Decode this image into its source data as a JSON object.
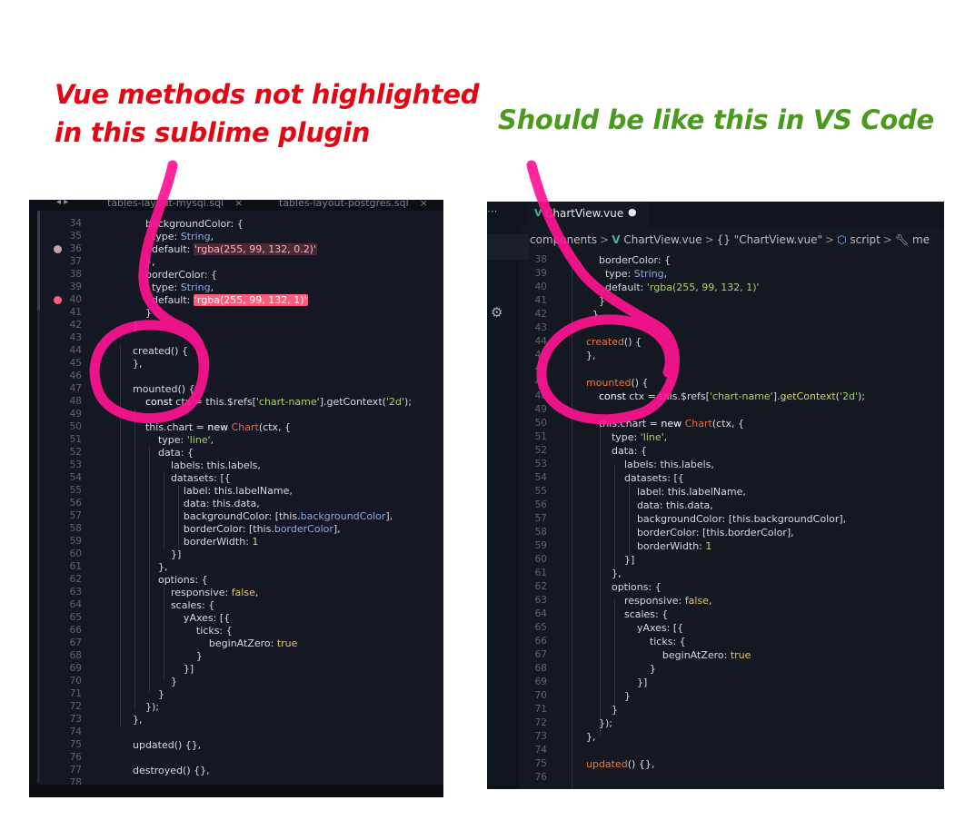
{
  "captions": {
    "left": [
      "Vue methods not highlighted",
      "in this sublime plugin"
    ],
    "right": "Should be like this in VS Code"
  },
  "sublime": {
    "tabs": [
      {
        "label": "tables-layout-mysql.sql",
        "close": "×"
      },
      {
        "label": "tables-layout-postgres.sql",
        "close": "×"
      }
    ],
    "nav_arrows": "◂ ▸",
    "line_numbers": [
      "34",
      "35",
      "36",
      "37",
      "38",
      "39",
      "40",
      "41",
      "42",
      "43",
      "44",
      "45",
      "46",
      "47",
      "48",
      "49",
      "50",
      "51",
      "52",
      "53",
      "54",
      "55",
      "56",
      "57",
      "58",
      "59",
      "60",
      "61",
      "62",
      "63",
      "64",
      "65",
      "66",
      "67",
      "68",
      "69",
      "70",
      "71",
      "72",
      "73",
      "74",
      "75",
      "76",
      "77",
      "78"
    ],
    "dots": {
      "line36": "#c8a0a8",
      "line40": "#ff5c7a"
    }
  },
  "vscode": {
    "more_icon": "···",
    "tab": {
      "label": "ChartView.vue",
      "modified_dot": "●"
    },
    "breadcrumb": [
      "components",
      "ChartView.vue",
      "{} \"ChartView.vue\"",
      "script",
      "me"
    ],
    "line_numbers": [
      "38",
      "39",
      "40",
      "41",
      "42",
      "43",
      "44",
      "45",
      "46",
      "47",
      "48",
      "49",
      "50",
      "51",
      "52",
      "53",
      "54",
      "55",
      "56",
      "57",
      "58",
      "59",
      "60",
      "61",
      "62",
      "63",
      "64",
      "65",
      "66",
      "67",
      "68",
      "69",
      "70",
      "71",
      "72",
      "73",
      "74",
      "75",
      "76"
    ]
  },
  "colors": {
    "caption_left": "#e30613",
    "caption_right": "#4a9a1e",
    "annotation": "#ff1493"
  }
}
